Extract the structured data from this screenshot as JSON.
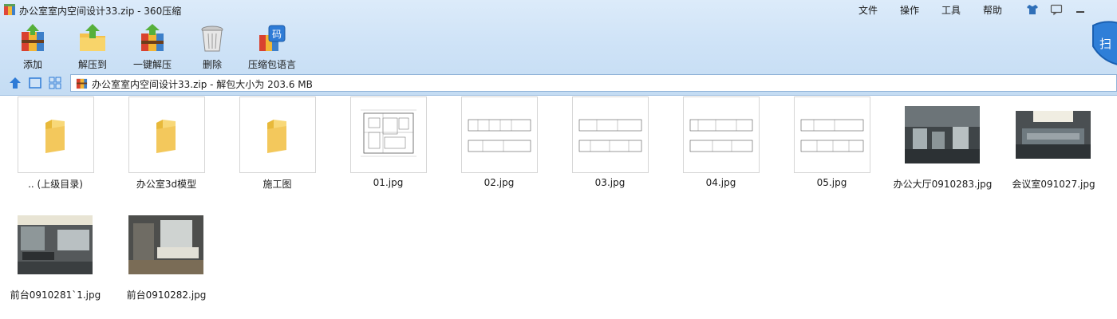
{
  "window": {
    "title": "办公室室内空间设计33.zip - 360压缩",
    "menu": [
      "文件",
      "操作",
      "工具",
      "帮助"
    ]
  },
  "toolbar": [
    {
      "label": "添加",
      "icon": "add-archive-icon"
    },
    {
      "label": "解压到",
      "icon": "extract-to-icon"
    },
    {
      "label": "一键解压",
      "icon": "one-click-extract-icon"
    },
    {
      "label": "删除",
      "icon": "delete-bin-icon"
    },
    {
      "label": "压缩包语言",
      "icon": "archive-language-icon"
    }
  ],
  "shield": {
    "label": "扫"
  },
  "address": {
    "path": "办公室室内空间设计33.zip - 解包大小为 203.6 MB"
  },
  "items": [
    {
      "name": ".. (上级目录)",
      "kind": "folder"
    },
    {
      "name": "办公室3d模型",
      "kind": "folder"
    },
    {
      "name": "施工图",
      "kind": "folder"
    },
    {
      "name": "01.jpg",
      "kind": "plan"
    },
    {
      "name": "02.jpg",
      "kind": "elevation"
    },
    {
      "name": "03.jpg",
      "kind": "elevation"
    },
    {
      "name": "04.jpg",
      "kind": "elevation"
    },
    {
      "name": "05.jpg",
      "kind": "elevation"
    },
    {
      "name": "办公大厅0910283.jpg",
      "kind": "photo-office"
    },
    {
      "name": "会议室091027.jpg",
      "kind": "photo-meeting"
    },
    {
      "name": "前台0910281`1.jpg",
      "kind": "photo-lobby"
    },
    {
      "name": "前台0910282.jpg",
      "kind": "photo-reception"
    }
  ]
}
